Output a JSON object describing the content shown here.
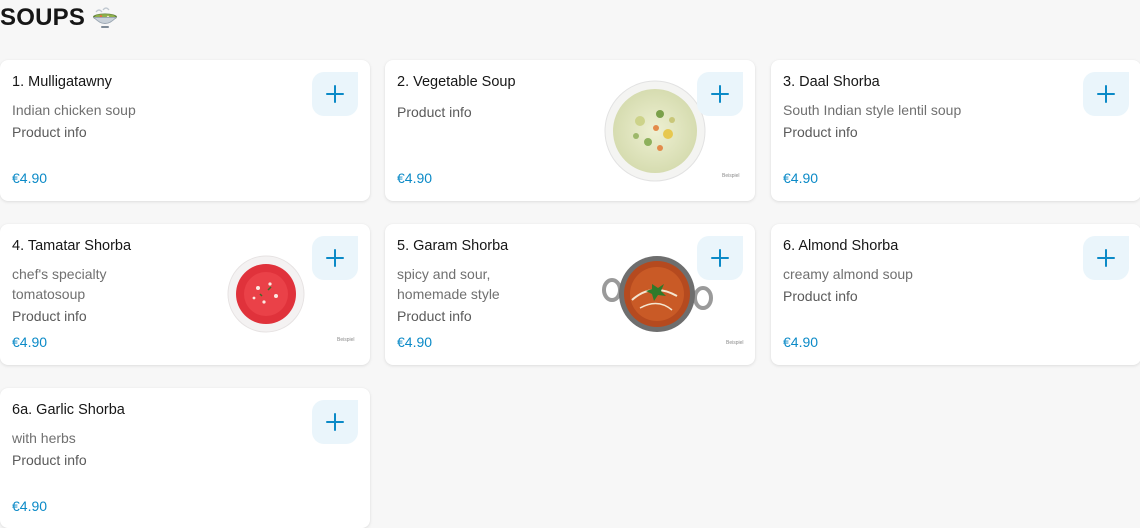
{
  "section": {
    "title": "SOUPS",
    "icon": "soup-bowl-icon"
  },
  "colors": {
    "accent": "#0b8ac7",
    "add_bg": "#eaf5fb",
    "page_bg": "#f7f7f7"
  },
  "products": [
    {
      "name": "1. Mulligatawny",
      "desc": "Indian chicken soup",
      "info": "Product info",
      "price": "€4.90"
    },
    {
      "name": "2. Vegetable Soup",
      "desc": "",
      "info": "Product info",
      "price": "€4.90",
      "caption": "Beispiel"
    },
    {
      "name": "3. Daal Shorba",
      "desc": "South Indian style lentil soup",
      "info": "Product info",
      "price": "€4.90"
    },
    {
      "name": "4. Tamatar Shorba",
      "desc": "chef's specialty tomatosoup",
      "info": "Product info",
      "price": "€4.90",
      "caption": "Beispiel"
    },
    {
      "name": "5. Garam Shorba",
      "desc": "spicy and sour, homemade style",
      "info": "Product info",
      "price": "€4.90",
      "caption": "Beispiel"
    },
    {
      "name": "6. Almond Shorba",
      "desc": "creamy almond soup",
      "info": "Product info",
      "price": "€4.90"
    },
    {
      "name": "6a. Garlic Shorba",
      "desc": "with herbs",
      "info": "Product info",
      "price": "€4.90"
    }
  ]
}
